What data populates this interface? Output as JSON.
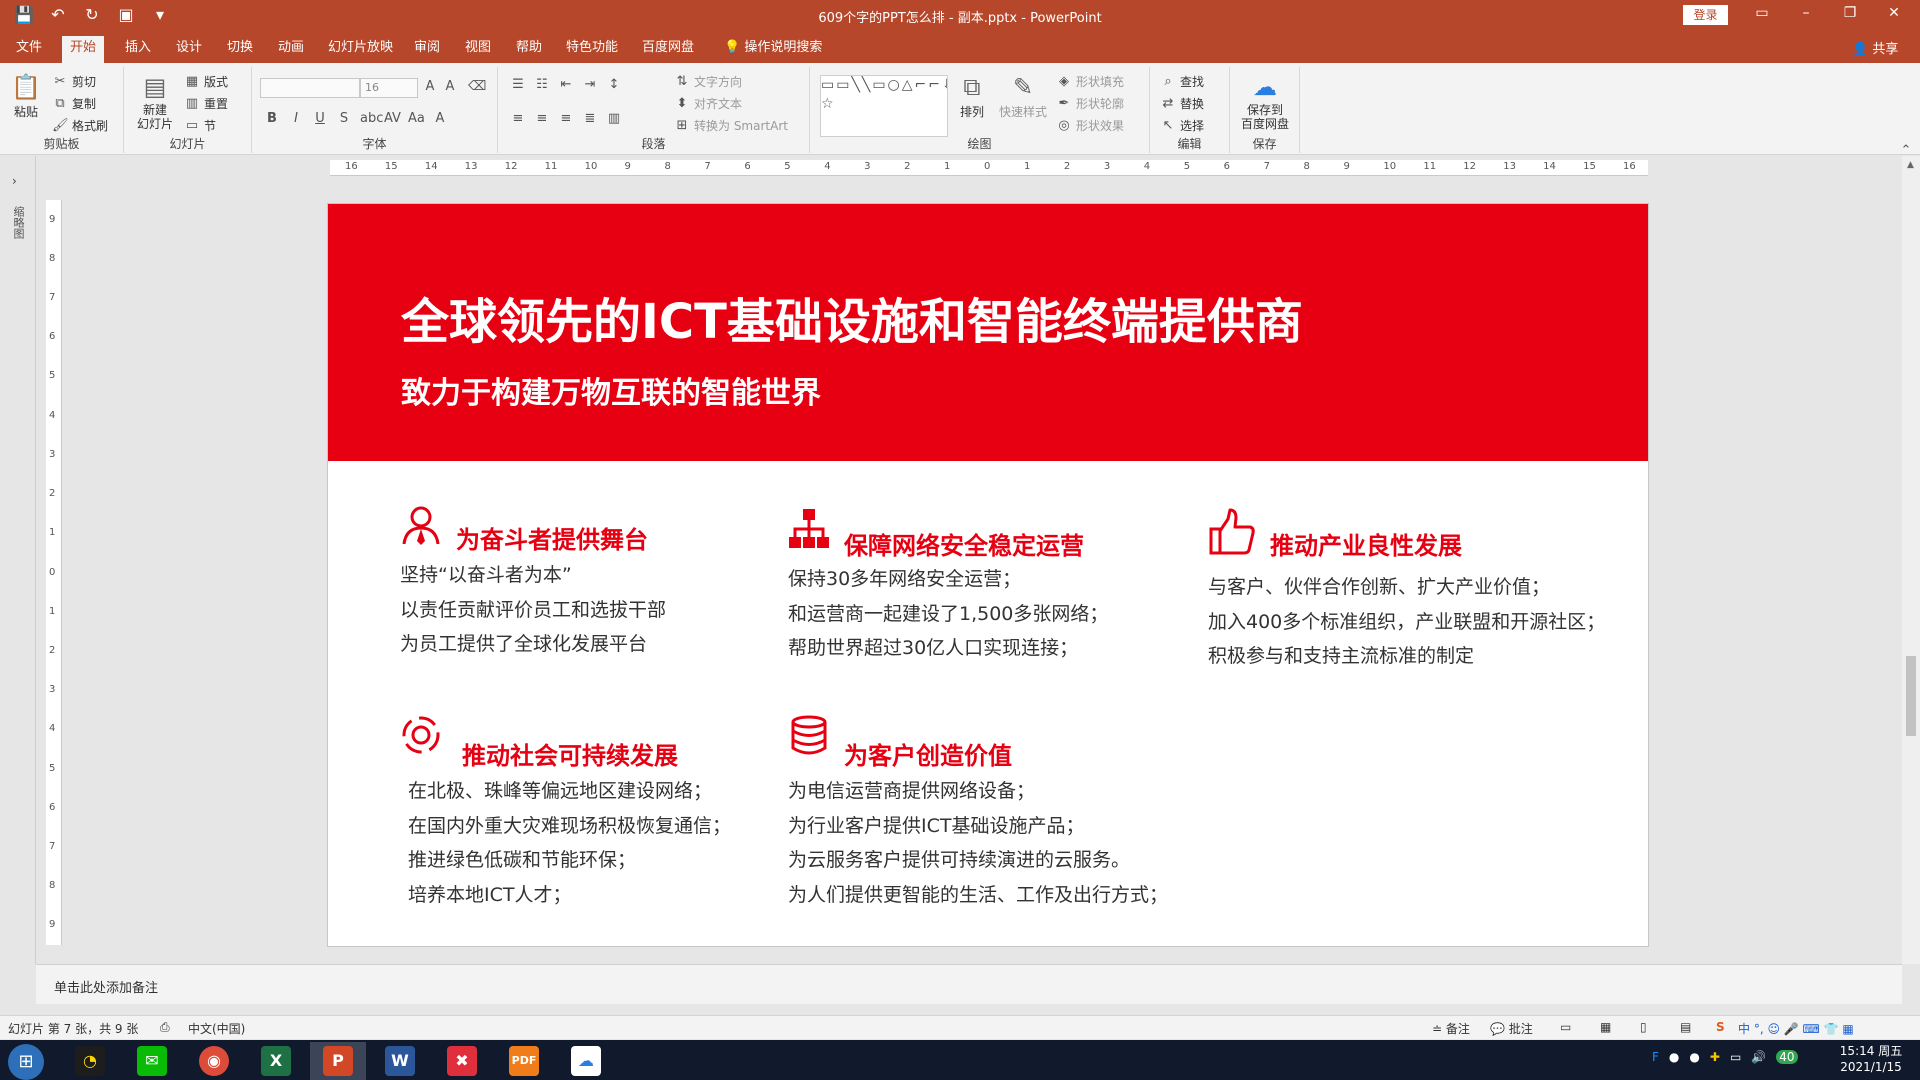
{
  "window": {
    "title": "609个字的PPT怎么排 - 副本.pptx  -  PowerPoint",
    "login_label": "登录"
  },
  "tabs": [
    "文件",
    "开始",
    "插入",
    "设计",
    "切换",
    "动画",
    "幻灯片放映",
    "审阅",
    "视图",
    "帮助",
    "特色功能",
    "百度网盘"
  ],
  "active_tab": "开始",
  "tell_me": "操作说明搜索",
  "share_label": "共享",
  "ribbon": {
    "clipboard": {
      "paste": "粘贴",
      "cut": "剪切",
      "copy": "复制",
      "format_painter": "格式刷",
      "label": "剪贴板"
    },
    "slides": {
      "new_slide": "新建\n幻灯片",
      "layout": "版式",
      "reset": "重置",
      "section": "节",
      "label": "幻灯片"
    },
    "font": {
      "size": "16",
      "label": "字体",
      "bold": "B",
      "italic": "I",
      "underline": "U",
      "strike": "S",
      "shadow": "abc",
      "spacing": "AV",
      "case": "Aa",
      "color": "A"
    },
    "paragraph": {
      "text_direction": "文字方向",
      "align_text": "对齐文本",
      "smartart": "转换为 SmartArt",
      "label": "段落"
    },
    "drawing": {
      "arrange": "排列",
      "quick_styles": "快速样式",
      "shape_fill": "形状填充",
      "shape_outline": "形状轮廓",
      "shape_effects": "形状效果",
      "label": "绘图"
    },
    "editing": {
      "find": "查找",
      "replace": "替换",
      "select": "选择",
      "label": "编辑"
    },
    "save": {
      "save_to_baidu": "保存到\n百度网盘",
      "label": "保存"
    }
  },
  "sidebar_vertical_label": "缩略图",
  "hruler_ticks": [
    "16",
    "15",
    "14",
    "13",
    "12",
    "11",
    "10",
    "9",
    "8",
    "7",
    "6",
    "5",
    "4",
    "3",
    "2",
    "1",
    "0",
    "1",
    "2",
    "3",
    "4",
    "5",
    "6",
    "7",
    "8",
    "9",
    "10",
    "11",
    "12",
    "13",
    "14",
    "15",
    "16"
  ],
  "vruler_ticks": [
    "9",
    "8",
    "7",
    "6",
    "5",
    "4",
    "3",
    "2",
    "1",
    "0",
    "1",
    "2",
    "3",
    "4",
    "5",
    "6",
    "7",
    "8",
    "9"
  ],
  "slide": {
    "title": "全球领先的ICT基础设施和智能终端提供商",
    "subtitle": "致力于构建万物互联的智能世界",
    "blocks": [
      {
        "icon": "person-icon",
        "title": "为奋斗者提供舞台",
        "lines": [
          "坚持“以奋斗者为本”",
          "以责任贡献评价员工和选拔干部",
          "为员工提供了全球化发展平台"
        ]
      },
      {
        "icon": "network-icon",
        "title": "保障网络安全稳定运营",
        "lines": [
          "保持30多年网络安全运营；",
          "和运营商一起建设了1,500多张网络；",
          "帮助世界超过30亿人口实现连接；"
        ]
      },
      {
        "icon": "thumbs-up-icon",
        "title": "推动产业良性发展",
        "lines": [
          "与客户、伙伴合作创新、扩大产业价值；",
          "加入400多个标准组织，产业联盟和开源社区；",
          "积极参与和支持主流标准的制定"
        ]
      },
      {
        "icon": "recycle-icon",
        "title": "推动社会可持续发展",
        "lines": [
          "在北极、珠峰等偏远地区建设网络；",
          "在国内外重大灾难现场积极恢复通信；",
          "推进绿色低碳和节能环保；",
          "培养本地ICT人才；"
        ]
      },
      {
        "icon": "database-icon",
        "title": "为客户创造价值",
        "lines": [
          "为电信运营商提供网络设备；",
          "为行业客户提供ICT基础设施产品；",
          "为云服务客户提供可持续演进的云服务。",
          "为人们提供更智能的生活、工作及出行方式；"
        ]
      }
    ]
  },
  "notes_placeholder": "单击此处添加备注",
  "status": {
    "slide_info": "幻灯片 第 7 张，共 9 张",
    "language": "中文(中国)",
    "notes": "备注",
    "comments": "批注"
  },
  "taskbar": {
    "time": "15:14 周五",
    "date": "2021/1/15",
    "tray_number": "40"
  },
  "colors": {
    "brand_red": "#e60012",
    "ppt_orange": "#b7472a"
  }
}
